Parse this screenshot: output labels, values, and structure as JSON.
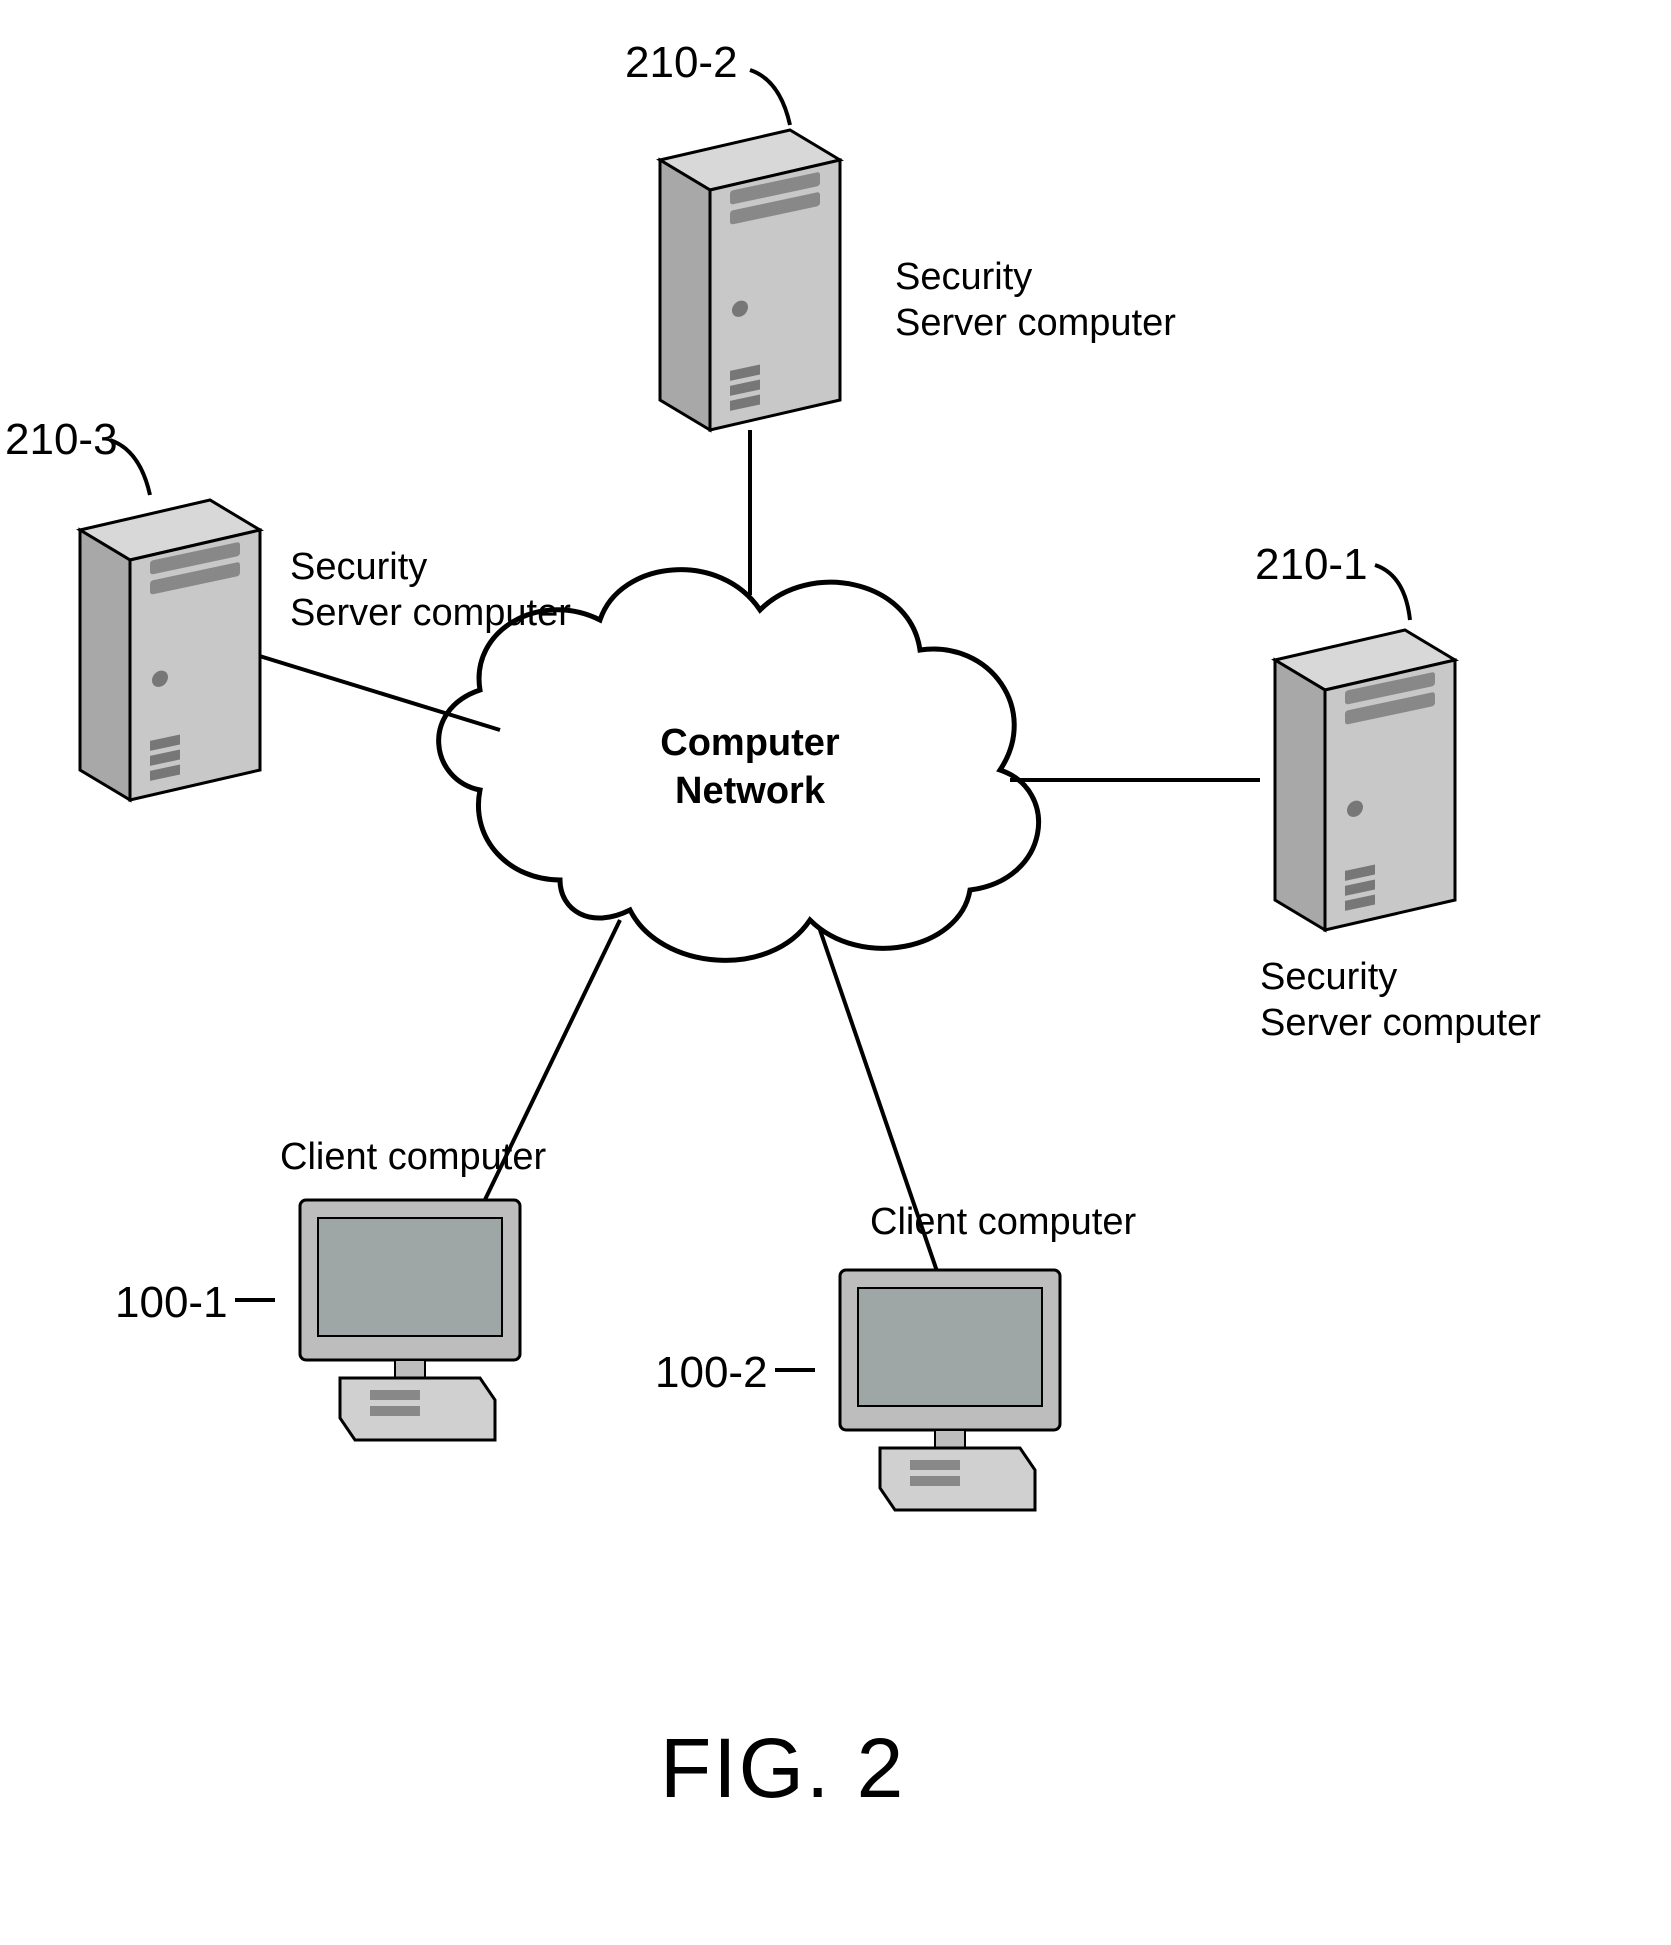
{
  "figure_caption": "FIG. 2",
  "cloud_label_line1": "Computer",
  "cloud_label_line2": "Network",
  "nodes": {
    "server_210_1": {
      "ref": "210-1",
      "label": "Security\nServer computer"
    },
    "server_210_2": {
      "ref": "210-2",
      "label": "Security\nServer computer"
    },
    "server_210_3": {
      "ref": "210-3",
      "label": "Security\nServer computer"
    },
    "client_100_1": {
      "ref": "100-1",
      "label": "Client computer"
    },
    "client_100_2": {
      "ref": "100-2",
      "label": "Client computer"
    }
  }
}
